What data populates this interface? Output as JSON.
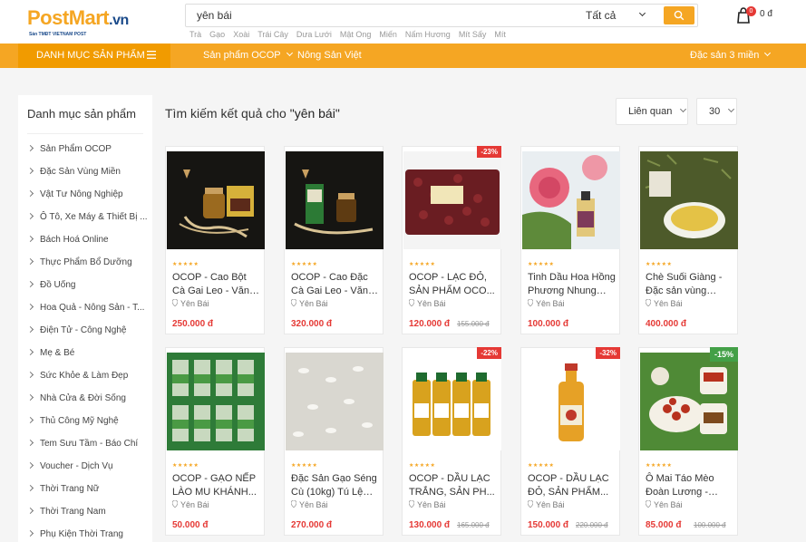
{
  "logo": {
    "post": "Post",
    "mart": "Mart",
    "vn": ".vn",
    "tagline": "Sàn TMĐT VIETNAM POST"
  },
  "search": {
    "value": "yên bái",
    "category": "Tất cả"
  },
  "suggestions": [
    "Trà",
    "Gạo",
    "Xoài",
    "Trái Cây",
    "Dưa Lưới",
    "Mật Ong",
    "Miến",
    "Nấm Hương",
    "Mít Sấy",
    "Mít"
  ],
  "cart": {
    "count": "0",
    "total": "0 đ"
  },
  "nav": {
    "category_label": "DANH MỤC SẢN PHẨM",
    "links": [
      "Sản phẩm OCOP",
      "Nông Sản Việt",
      "Đặc sản 3 miền"
    ]
  },
  "sidebar": {
    "title": "Danh mục sản phẩm",
    "items": [
      "Sản Phẩm OCOP",
      "Đặc Sản Vùng Miền",
      "Vật Tư Nông Nghiệp",
      "Ô Tô, Xe Máy & Thiết Bị ...",
      "Bách Hoá Online",
      "Thực Phẩm Bổ Dưỡng",
      "Đồ Uống",
      "Hoa Quả - Nông Sản - T...",
      "Điện Tử - Công Nghệ",
      "Mẹ & Bé",
      "Sức Khỏe & Làm Đẹp",
      "Nhà Cửa & Đời Sống",
      "Thủ Công Mỹ Nghệ",
      "Tem Sưu Tầm - Báo Chí",
      "Voucher - Dịch Vụ",
      "Thời Trang Nữ",
      "Thời Trang Nam",
      "Phụ Kiện Thời Trang"
    ]
  },
  "results": {
    "prefix": "Tìm kiếm kết quả cho ",
    "query": "\"yên bái\""
  },
  "sort": {
    "selected": "Liên quan",
    "page_size": "30"
  },
  "products": [
    {
      "name": "OCOP - Cao Bột Cà Gai Leo - Văn Yên...",
      "location": "Yên Bái",
      "price": "250.000 đ",
      "old_price": "",
      "discount": "",
      "image": "ca-gai-leo-box"
    },
    {
      "name": "OCOP - Cao Đặc Cà Gai Leo - Văn Yên...",
      "location": "Yên Bái",
      "price": "320.000 đ",
      "old_price": "",
      "discount": "",
      "image": "ca-gai-leo-jar"
    },
    {
      "name": "OCOP - LẠC ĐỎ, SẢN PHẨM OCO...",
      "location": "Yên Bái",
      "price": "120.000 đ",
      "old_price": "155.000 đ",
      "discount": "-23%",
      "image": "red-peanuts"
    },
    {
      "name": "Tinh Dầu Hoa Hồng Phương Nhung Vă...",
      "location": "Yên Bái",
      "price": "100.000 đ",
      "old_price": "",
      "discount": "",
      "image": "rose-oil"
    },
    {
      "name": "Chè Suối Giàng - Đặc sản vùng cao...",
      "location": "Yên Bái",
      "price": "400.000 đ",
      "old_price": "",
      "discount": "",
      "image": "green-tea"
    },
    {
      "name": "OCOP - GẠO NẾP LÀO MU KHÁNH...",
      "location": "Yên Bái",
      "price": "50.000 đ",
      "old_price": "",
      "discount": "",
      "image": "rice-bags"
    },
    {
      "name": "Đặc Sản Gạo Séng Cù (10kg) Tú Lệ Y...",
      "location": "Yên Bái",
      "price": "270.000 đ",
      "old_price": "",
      "discount": "",
      "image": "white-rice"
    },
    {
      "name": "OCOP - DẦU LẠC TRẮNG, SẢN PH...",
      "location": "Yên Bái",
      "price": "130.000 đ",
      "old_price": "165.000 đ",
      "discount": "-22%",
      "image": "oil-bottles"
    },
    {
      "name": "OCOP - DẦU LẠC ĐỎ, SẢN PHẨM...",
      "location": "Yên Bái",
      "price": "150.000 đ",
      "old_price": "220.000 đ",
      "discount": "-32%",
      "image": "oil-bottle"
    },
    {
      "name": "Ô Mai Táo Mèo Đoàn Lương - Đặc...",
      "location": "Yên Bái",
      "price": "85.000 đ",
      "old_price": "100.000 đ",
      "discount": "-15%",
      "image": "o-mai"
    }
  ],
  "colors": {
    "accent": "#f5a623",
    "accent_dark": "#f19b00",
    "price": "#e53935",
    "brand_blue": "#1a4a8a"
  }
}
